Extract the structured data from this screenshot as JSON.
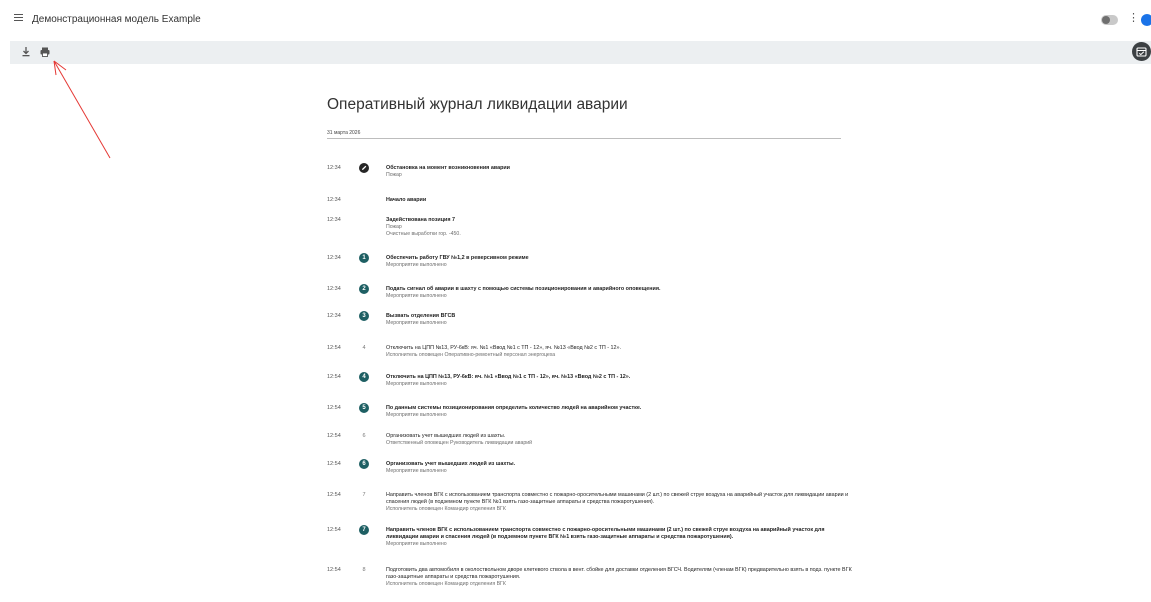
{
  "app": {
    "title": "Демонстрационная модель Example"
  },
  "icons": {
    "menu": "menu-icon",
    "download": "download-icon",
    "print": "print-icon",
    "more": "more-vert-icon",
    "account": "account-icon",
    "toggle": "toggle-switch",
    "calendar_check": "calendar-check-icon",
    "pencil": "pencil-icon"
  },
  "colors": {
    "badge": "#1e5f63",
    "toolbar_bg": "#eceff1",
    "annotation_arrow": "#e53935",
    "accent": "#1a73e8"
  },
  "document": {
    "title": "Оперативный журнал ликвидации аварии",
    "date": "31 марта 2026",
    "entries": [
      {
        "time": "12:34",
        "marker": "",
        "main": "Обстановка на момент возникновения аварии",
        "sub": [
          "Пожар"
        ]
      },
      {
        "time": "12:34",
        "marker": "",
        "main": "Начало аварии",
        "sub": []
      },
      {
        "time": "12:34",
        "marker": "",
        "main": "Задействована позиция 7",
        "sub": [
          "Пожар",
          "Очистные выработки гор. -450."
        ]
      },
      {
        "time": "12:34",
        "marker": "1",
        "main": "Обеспечить работу ГВУ №1,2 в реверсивном режиме",
        "sub": [
          "Мероприятие выполнено"
        ]
      },
      {
        "time": "12:34",
        "marker": "2",
        "main": "Подать сигнал об аварии в шахту с помощью системы позиционирования и аварийного оповещения.",
        "sub": [
          "Мероприятие выполнено"
        ]
      },
      {
        "time": "12:34",
        "marker": "3",
        "main": "Вызвать отделения ВГСВ",
        "sub": [
          "Мероприятие выполнено"
        ]
      },
      {
        "time": "12:54",
        "marker": "4",
        "main": "Отключить на ЦПП №13, РУ-6кВ: яч. №1 «Ввод №1 с ТП - 12», яч. №13 «Ввод №2 с ТП - 12».",
        "sub": [
          "Исполнитель оповещен Оперативно-ремонтный персонал энергоцеха"
        ]
      },
      {
        "time": "12:54",
        "marker": "4",
        "main": "Отключить на ЦПП №13, РУ-6кВ: яч. №1 «Ввод №1 с ТП - 12», яч. №13 «Ввод №2 с ТП - 12».",
        "sub": [
          "Мероприятие выполнено"
        ]
      },
      {
        "time": "12:54",
        "marker": "5",
        "main": "По данным системы позиционирования определить количество людей на аварийном участке.",
        "sub": [
          "Мероприятие выполнено"
        ]
      },
      {
        "time": "12:54",
        "marker": "6",
        "main": "Организовать учет вышедших людей из шахты.",
        "sub": [
          "Ответственный оповещен Руководитель ликвидации аварий"
        ]
      },
      {
        "time": "12:54",
        "marker": "6",
        "main": "Организовать учет вышедших людей из шахты.",
        "sub": [
          "Мероприятие выполнено"
        ]
      },
      {
        "time": "12:54",
        "marker": "7",
        "main": "Направить членов ВГК с использованием транспорта совместно с пожарно-оросительными машинами (2 шт.) по свежей струе воздуха на аварийный участок для ликвидации аварии и спасения людей (в подземном пункте ВГК №1 взять газо-защитные аппараты и средства пожаротушения).",
        "sub": [
          "Исполнитель оповещен Командир отделения ВГК"
        ]
      },
      {
        "time": "12:54",
        "marker": "7",
        "main": "Направить членов ВГК с использованием транспорта совместно с пожарно-оросительными машинами (2 шт.) по свежей струе воздуха на аварийный участок для ликвидации аварии и спасения людей (в подземном пункте ВГК №1 взять газо-защитные аппараты и средства пожаротушения).",
        "sub": [
          "Мероприятие выполнено"
        ]
      },
      {
        "time": "12:54",
        "marker": "8",
        "main": "Подготовить два автомобиля в околоствольном дворе клетевого ствола в вент. сбойке для доставки отделения ВГСЧ. Водителям (членам ВГК) предварительно взять в подз. пункте ВГК газо-защитные аппараты и средства пожаротушения.",
        "sub": [
          "Исполнитель оповещен Командир отделения ВГК"
        ]
      }
    ]
  }
}
